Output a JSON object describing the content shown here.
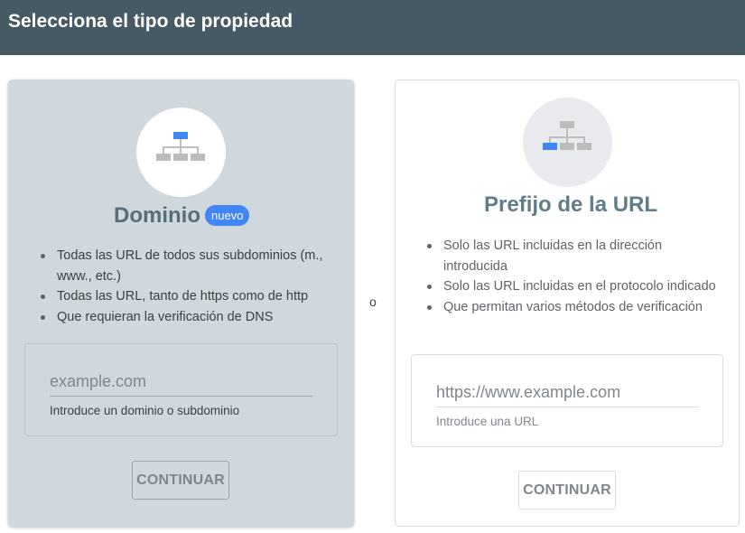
{
  "header": {
    "title": "Selecciona el tipo de propiedad"
  },
  "separator": "o",
  "domain_card": {
    "icon": "sitemap-icon",
    "title": "Dominio",
    "badge": "nuevo",
    "features": [
      "Todas las URL de todos sus subdominios (m., www., etc.)",
      "Todas las URL, tanto de https como de http",
      "Que requieran la verificación de DNS"
    ],
    "input": {
      "placeholder": "example.com",
      "value": "",
      "hint": "Introduce un dominio o subdominio"
    },
    "button_label": "CONTINUAR"
  },
  "prefix_card": {
    "icon": "sitemap-icon",
    "title": "Prefijo de la URL",
    "features": [
      "Solo las URL incluidas en la dirección introducida",
      "Solo las URL incluidas en el protocolo indicado",
      "Que permitan varios métodos de verificación"
    ],
    "input": {
      "placeholder": "https://www.example.com",
      "value": "",
      "hint": "Introduce una URL"
    },
    "button_label": "CONTINUAR"
  },
  "colors": {
    "header_bg": "#455a64",
    "domain_card_bg": "#cfd8dc",
    "accent_blue": "#4285f4",
    "icon_gray": "#bdbdbd"
  }
}
